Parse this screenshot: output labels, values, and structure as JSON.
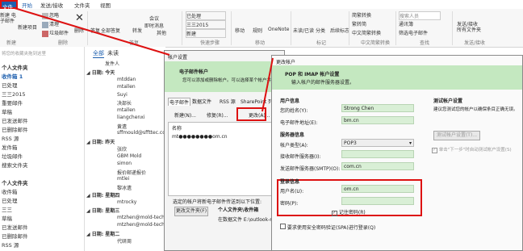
{
  "tabs": {
    "file": "文件",
    "home": "开始",
    "send_receive": "发送/接收",
    "folder": "文件夹",
    "view": "视图"
  },
  "ribbon": {
    "new_email": "新建\n电子邮件",
    "new_items": "新建项目",
    "ignore": "忽略",
    "cleanup": "清理",
    "junk": "垃圾邮件",
    "delete": "删除",
    "reply": "答复",
    "reply_all": "全部答复",
    "forward": "转发",
    "meeting": "会议",
    "im": "即时消息",
    "more": "其他",
    "qs1": "已处理",
    "qs2": "三三2015",
    "qs3": "新建",
    "move": "移动",
    "rules": "规则",
    "onenote": "OneNote",
    "unread": "未读/已读",
    "categorize": "分类",
    "followup": "后续标志",
    "simp_trad": "简繁转换",
    "trad_simp": "繁转简",
    "chinese_conv": "中文简繁转换",
    "search_people": "搜索人员",
    "address_book": "通讯簿",
    "filter_email": "筛选电子邮件",
    "send_receive_all": "发送/接收\n所有文件夹",
    "groups": {
      "new": "新建",
      "delete": "删除",
      "respond": "答复",
      "quick": "快速步骤",
      "move": "移动",
      "tags": "标记",
      "chinese": "中文简繁转换",
      "find": "查找",
      "sendrecv": "发送/接收"
    }
  },
  "nav": {
    "drag_hint": "将您的收藏夹拖到这里",
    "items": [
      "个人文件夹",
      "收件箱 1",
      "已处理",
      "三三2015",
      "重要邮件",
      "草稿",
      "已发送邮件",
      "已删除邮件",
      "RSS 源",
      "发件箱",
      "垃圾邮件",
      "搜索文件夹",
      "",
      "个人文件夹",
      "收件箱",
      "已处理",
      "三三",
      "草稿",
      "已发送邮件",
      "已删除邮件",
      "RSS 源"
    ]
  },
  "msglist": {
    "all": "全部",
    "unread": "未读",
    "col_from": "发件人",
    "rows": [
      "日期: 今天",
      "mtddan",
      "mtallen",
      "Suyi",
      "决部长",
      "mtallen",
      "liangchenxi",
      "黄遗",
      "sffmould@sffttec.com",
      "日期: 昨天",
      "张欣",
      "GBM Mold",
      "simon",
      "报价邮递报价",
      "mtlei",
      "黎冰遗",
      "日期: 星期四",
      "mtrocky",
      "日期: 星期三",
      "mtzhen@mold-tech",
      "mtzhen@mold-tech",
      "日期: 星期二",
      "代研周"
    ]
  },
  "dlg1": {
    "title": "帐户设置",
    "header": "电子邮件帐户",
    "subheader": "您可以添加或删除帐户。可以选择某个帐户并更改其设置。",
    "tabs": [
      "电子邮件",
      "数据文件",
      "RSS 源",
      "SharePoint 列"
    ],
    "new": "新建(N)...",
    "repair": "修复(R)...",
    "change": "更改(A)...",
    "col_name": "名称",
    "account": "mt●●●●●●●●om.cn",
    "deliver_label": "选定的帐户将新电子邮件传送到以下位置:",
    "change_folder": "更改文件夹(F)",
    "folder_title": "个人文件夹\\收件箱",
    "folder_path": "在数据文件 E:\\outlook-m"
  },
  "dlg2": {
    "title": "更改帐户",
    "header": "POP 和 IMAP 帐户设置",
    "subheader": "输入帐户的邮件服务器设置。",
    "user_info": "用户信息",
    "your_name_label": "您的姓名(Y):",
    "your_name": "Strong Chen",
    "email_label": "电子邮件地址(E):",
    "email": "bm.cn",
    "server_info": "服务器信息",
    "acct_type_label": "帐户类型(A):",
    "acct_type": "POP3",
    "incoming_label": "接收邮件服务器(I):",
    "incoming": "",
    "outgoing_label": "发送邮件服务器(SMTP)(O):",
    "outgoing": "com.cn",
    "login_info": "登录信息",
    "user_label": "用户名(U):",
    "user": "om.cn",
    "pass_label": "密码(P):",
    "pass": "",
    "remember": "记住密码(R)",
    "spa": "要求使用安全密码验证(SPA)进行登录(Q)",
    "test_header": "测试帐户设置",
    "test_desc": "建议您测试您的帐户以确保条目正确无误。",
    "test_btn": "测试帐户设置(T)...",
    "auto_test": "单击\"下一步\"时自动测试帐户设置(S)"
  },
  "colors": {
    "accent": "#1e5fae",
    "highlight": "#d11",
    "field_green": "#d9efd6",
    "header_green": "#c4e8c0"
  }
}
